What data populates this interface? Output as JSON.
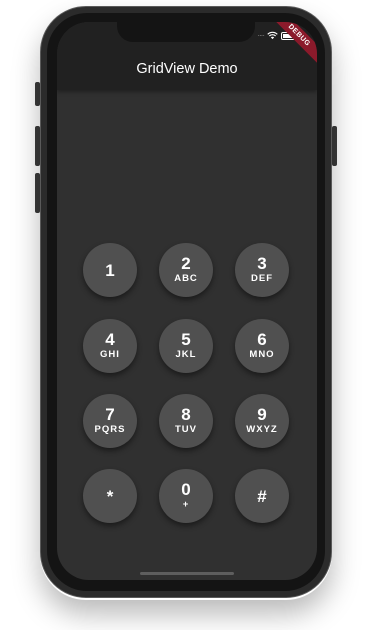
{
  "appbar": {
    "title": "GridView Demo"
  },
  "debug_banner": "DEBUG",
  "keys": [
    {
      "digit": "1",
      "letters": ""
    },
    {
      "digit": "2",
      "letters": "ABC"
    },
    {
      "digit": "3",
      "letters": "DEF"
    },
    {
      "digit": "4",
      "letters": "GHI"
    },
    {
      "digit": "5",
      "letters": "JKL"
    },
    {
      "digit": "6",
      "letters": "MNO"
    },
    {
      "digit": "7",
      "letters": "PQRS"
    },
    {
      "digit": "8",
      "letters": "TUV"
    },
    {
      "digit": "9",
      "letters": "WXYZ"
    },
    {
      "digit": "*",
      "letters": ""
    },
    {
      "digit": "0",
      "letters": "+"
    },
    {
      "digit": "#",
      "letters": ""
    }
  ],
  "colors": {
    "screen_bg": "#303030",
    "appbar_bg": "#212121",
    "key_bg": "#505050",
    "debug_banner": "#8b1a2b"
  },
  "icons": [
    "wifi-icon",
    "battery-icon",
    "signal-dots-icon"
  ]
}
